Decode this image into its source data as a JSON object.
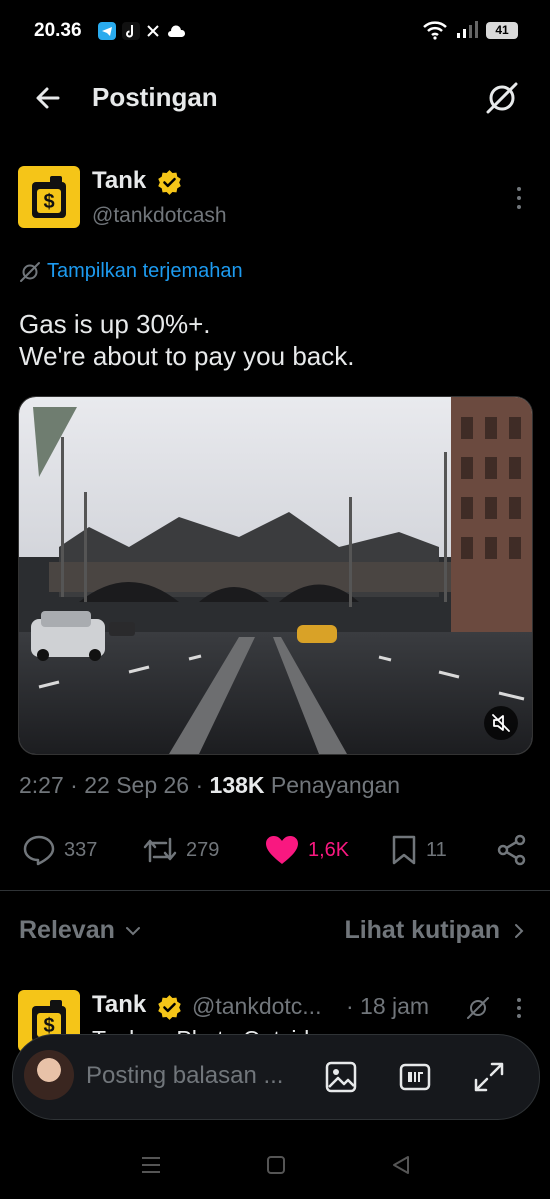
{
  "status_bar": {
    "time": "20.36",
    "battery": "41"
  },
  "header": {
    "title": "Postingan"
  },
  "post": {
    "author_name": "Tank",
    "handle": "@tankdotcash",
    "translate_label": "Tampilkan terjemahan",
    "text": "Gas is up 30%+.\nWe're about to pay you back.",
    "meta": {
      "time": "2:27",
      "date": "22 Sep 26",
      "views_count": "138K",
      "views_label": "Penayangan"
    },
    "actions": {
      "replies": "337",
      "reposts": "279",
      "likes": "1,6K",
      "bookmarks": "11"
    }
  },
  "replies_bar": {
    "sort_label": "Relevan",
    "quotes_label": "Lihat kutipan"
  },
  "reply_preview": {
    "author_name": "Tank",
    "handle": "@tankdotc...",
    "time": "· 18 jam",
    "text": "Tank — Photo Outside"
  },
  "composer": {
    "placeholder": "Posting balasan ..."
  },
  "colors": {
    "accent": "#1d9bf0",
    "like": "#f91880",
    "verified": "#f5c518",
    "brand": "#f5c518"
  }
}
